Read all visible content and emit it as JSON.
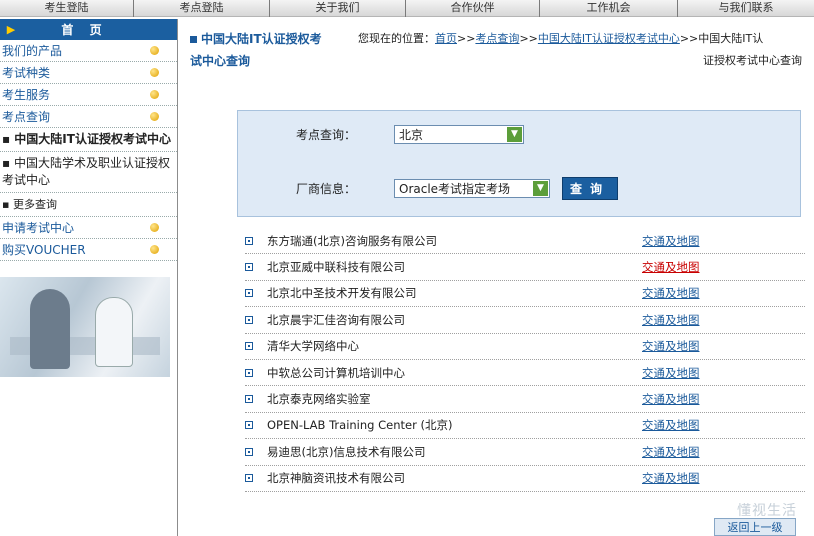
{
  "topnav": [
    {
      "label": "考生登陆"
    },
    {
      "label": "考点登陆"
    },
    {
      "label": "关于我们"
    },
    {
      "label": "合作伙伴"
    },
    {
      "label": "工作机会"
    },
    {
      "label": "与我们联系"
    }
  ],
  "sidebar": {
    "home_label": "首 页",
    "menu": [
      {
        "label": "我们的产品"
      },
      {
        "label": "考试种类"
      },
      {
        "label": "考生服务"
      },
      {
        "label": "考点查询"
      }
    ],
    "subitems": [
      {
        "label": "▪ 中国大陆IT认证授权考试中心"
      },
      {
        "label": "▪ 中国大陆学术及职业认证授权考试中心"
      },
      {
        "label": "▪ 更多查询"
      }
    ],
    "menu2": [
      {
        "label": "申请考试中心"
      },
      {
        "label": "购买VOUCHER"
      }
    ]
  },
  "header": {
    "title_line1": "中国大陆IT认证授权考",
    "title_line2": "试中心查询",
    "location_prefix": "您现在的位置：",
    "crumb_home": "首页",
    "crumb_sep": ">>",
    "crumb_query": "考点查询",
    "crumb_center": "中国大陆IT认证授权考试中心",
    "crumb_tail1": "中国大陆IT认",
    "crumb_tail2": "证授权考试中心查询"
  },
  "search": {
    "location_label": "考点查询：",
    "location_value": "北京",
    "vendor_label": "厂商信息：",
    "vendor_value": "Oracle考试指定考场",
    "button": "查询"
  },
  "centers": [
    {
      "name": "东方瑞通(北京)咨询服务有限公司",
      "map": "交通及地图"
    },
    {
      "name": "北京亚威中联科技有限公司",
      "map": "交通及地图"
    },
    {
      "name": "北京北中圣技术开发有限公司",
      "map": "交通及地图"
    },
    {
      "name": "北京晨宇汇佳咨询有限公司",
      "map": "交通及地图"
    },
    {
      "name": "清华大学网络中心",
      "map": "交通及地图"
    },
    {
      "name": "中软总公司计算机培训中心",
      "map": "交通及地图"
    },
    {
      "name": "北京泰克网络实验室",
      "map": "交通及地图"
    },
    {
      "name": "OPEN-LAB Training Center (北京)",
      "map": "交通及地图"
    },
    {
      "name": "易迪思(北京)信息技术有限公司",
      "map": "交通及地图"
    },
    {
      "name": "北京神脑资讯技术有限公司",
      "map": "交通及地图"
    }
  ],
  "back_button": "返回上一级",
  "watermark": "懂视生活"
}
